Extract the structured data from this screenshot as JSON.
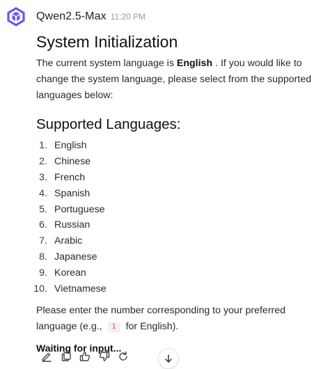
{
  "header": {
    "model_name": "Qwen2.5-Max",
    "timestamp": "11:20 PM",
    "avatar_icon": "qwen-logo-icon",
    "brand_color": "#615ced"
  },
  "message": {
    "title": "System Initialization",
    "intro_prefix": "The current system language is ",
    "current_language": "English",
    "intro_suffix": " . If you would like to change the system language, please select from the supported languages below:",
    "subtitle": "Supported Languages:",
    "languages": [
      {
        "num": "1.",
        "name": "English"
      },
      {
        "num": "2.",
        "name": "Chinese"
      },
      {
        "num": "3.",
        "name": "French"
      },
      {
        "num": "4.",
        "name": "Spanish"
      },
      {
        "num": "5.",
        "name": "Portuguese"
      },
      {
        "num": "6.",
        "name": "Russian"
      },
      {
        "num": "7.",
        "name": "Arabic"
      },
      {
        "num": "8.",
        "name": "Japanese"
      },
      {
        "num": "9.",
        "name": "Korean"
      },
      {
        "num": "10.",
        "name": "Vietnamese"
      }
    ],
    "prompt_prefix": "Please enter the number corresponding to your preferred language (e.g., ",
    "prompt_code": "1",
    "prompt_suffix": " for English).",
    "status": "Waiting for input..."
  },
  "actions": [
    {
      "name": "edit-icon"
    },
    {
      "name": "copy-icon"
    },
    {
      "name": "thumbs-up-icon"
    },
    {
      "name": "thumbs-down-icon"
    },
    {
      "name": "regenerate-icon"
    }
  ],
  "scroll_button_icon": "arrow-down-icon"
}
